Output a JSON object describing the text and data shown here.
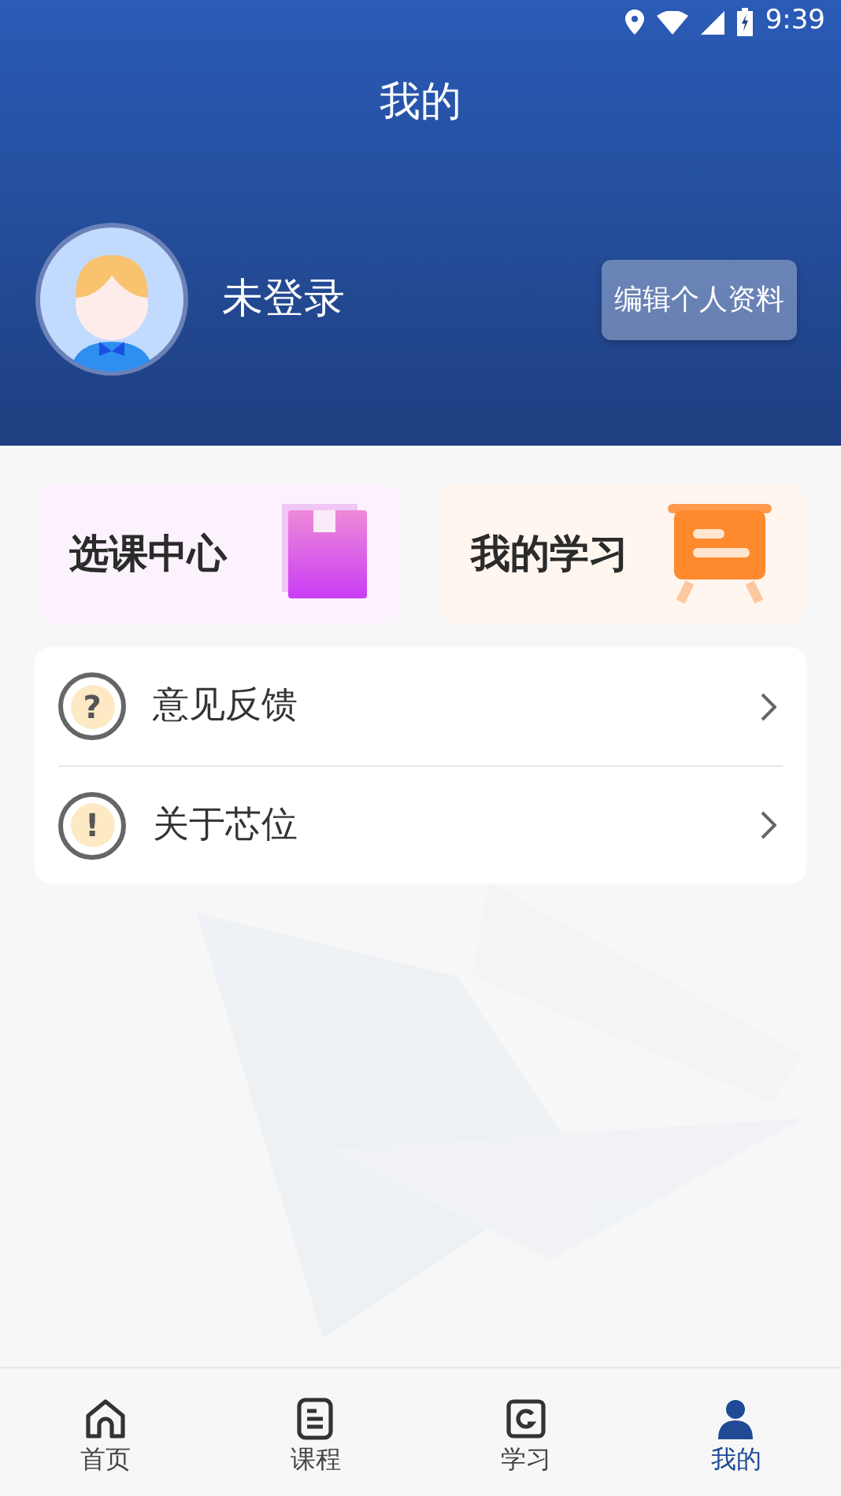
{
  "status_bar": {
    "time": "9:39"
  },
  "header": {
    "title": "我的",
    "user_name": "未登录",
    "edit_button": "编辑个人资料"
  },
  "shortcuts": [
    {
      "label": "选课中心",
      "kind": "book"
    },
    {
      "label": "我的学习",
      "kind": "board"
    }
  ],
  "menu": [
    {
      "label": "意见反馈",
      "icon": "?"
    },
    {
      "label": "关于芯位",
      "icon": "!"
    }
  ],
  "tabs": [
    {
      "label": "首页",
      "kind": "home",
      "selected": false
    },
    {
      "label": "课程",
      "kind": "course",
      "selected": false
    },
    {
      "label": "学习",
      "kind": "study",
      "selected": false
    },
    {
      "label": "我的",
      "kind": "profile",
      "selected": true
    }
  ]
}
